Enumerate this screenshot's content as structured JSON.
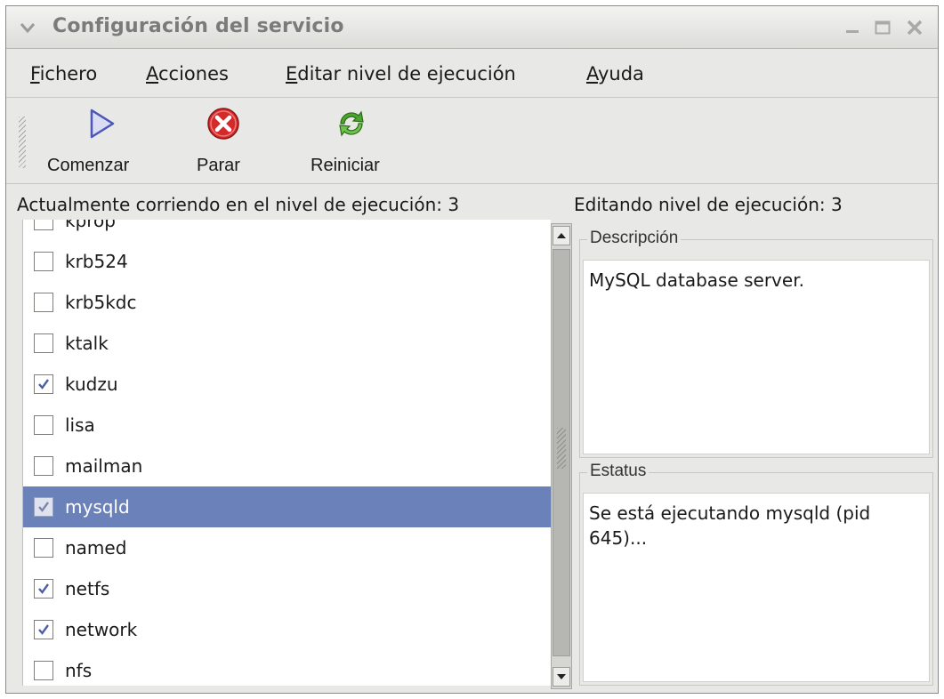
{
  "window": {
    "title": "Configuración del servicio"
  },
  "menu": {
    "items": [
      {
        "mnemonic": "F",
        "rest": "ichero"
      },
      {
        "mnemonic": "A",
        "rest": "cciones"
      },
      {
        "mnemonic": "E",
        "rest": "ditar nivel de ejecución"
      },
      {
        "mnemonic": "A",
        "rest": "yuda"
      }
    ]
  },
  "toolbar": {
    "start_label": "Comenzar",
    "stop_label": "Parar",
    "restart_label": "Reiniciar",
    "start_icon": "play-icon",
    "stop_icon": "stop-icon",
    "restart_icon": "restart-icon",
    "stop_color": "#d42a2a",
    "restart_color": "#4aa62e"
  },
  "runlevel": {
    "current": "Actualmente corriendo en el nivel de ejecución: 3",
    "editing": "Editando nivel de ejecución: 3"
  },
  "services": [
    {
      "name": "kprop",
      "checked": false,
      "selected": false
    },
    {
      "name": "krb524",
      "checked": false,
      "selected": false
    },
    {
      "name": "krb5kdc",
      "checked": false,
      "selected": false
    },
    {
      "name": "ktalk",
      "checked": false,
      "selected": false
    },
    {
      "name": "kudzu",
      "checked": true,
      "selected": false
    },
    {
      "name": "lisa",
      "checked": false,
      "selected": false
    },
    {
      "name": "mailman",
      "checked": false,
      "selected": false
    },
    {
      "name": "mysqld",
      "checked": true,
      "selected": true
    },
    {
      "name": "named",
      "checked": false,
      "selected": false
    },
    {
      "name": "netfs",
      "checked": true,
      "selected": false
    },
    {
      "name": "network",
      "checked": true,
      "selected": false
    },
    {
      "name": "nfs",
      "checked": false,
      "selected": false
    }
  ],
  "selection_color": "#6b81ba",
  "description": {
    "legend": "Descripción",
    "text": "MySQL database server."
  },
  "status": {
    "legend": "Estatus",
    "text": "Se está ejecutando mysqld (pid 645)..."
  }
}
